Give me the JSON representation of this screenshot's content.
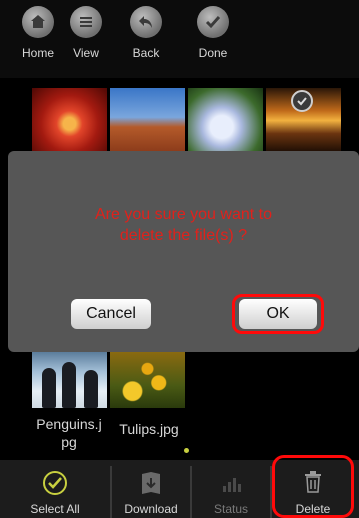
{
  "toolbar": {
    "items": [
      {
        "label": "Home",
        "icon": "home-icon"
      },
      {
        "label": "View",
        "icon": "list-icon"
      },
      {
        "label": "Back",
        "icon": "back-arrow-icon"
      },
      {
        "label": "Done",
        "icon": "checkmark-icon"
      }
    ]
  },
  "gallery": {
    "files": [
      {
        "name": "Penguins.jpg",
        "display": "Penguins.j\npg"
      },
      {
        "name": "Tulips.jpg",
        "display": "Tulips.jpg"
      }
    ]
  },
  "dialog": {
    "message_line1": "Are you sure you want to",
    "message_line2": "delete the file(s) ?",
    "cancel_label": "Cancel",
    "ok_label": "OK"
  },
  "bottombar": {
    "items": [
      {
        "label": "Select All",
        "icon": "select-all-icon"
      },
      {
        "label": "Download",
        "icon": "download-icon"
      },
      {
        "label": "Status",
        "icon": "status-icon"
      },
      {
        "label": "Delete",
        "icon": "trash-icon"
      }
    ]
  },
  "colors": {
    "alert_text": "#e0211b",
    "highlight": "#ff0a0a",
    "dialog_bg": "#565656"
  }
}
